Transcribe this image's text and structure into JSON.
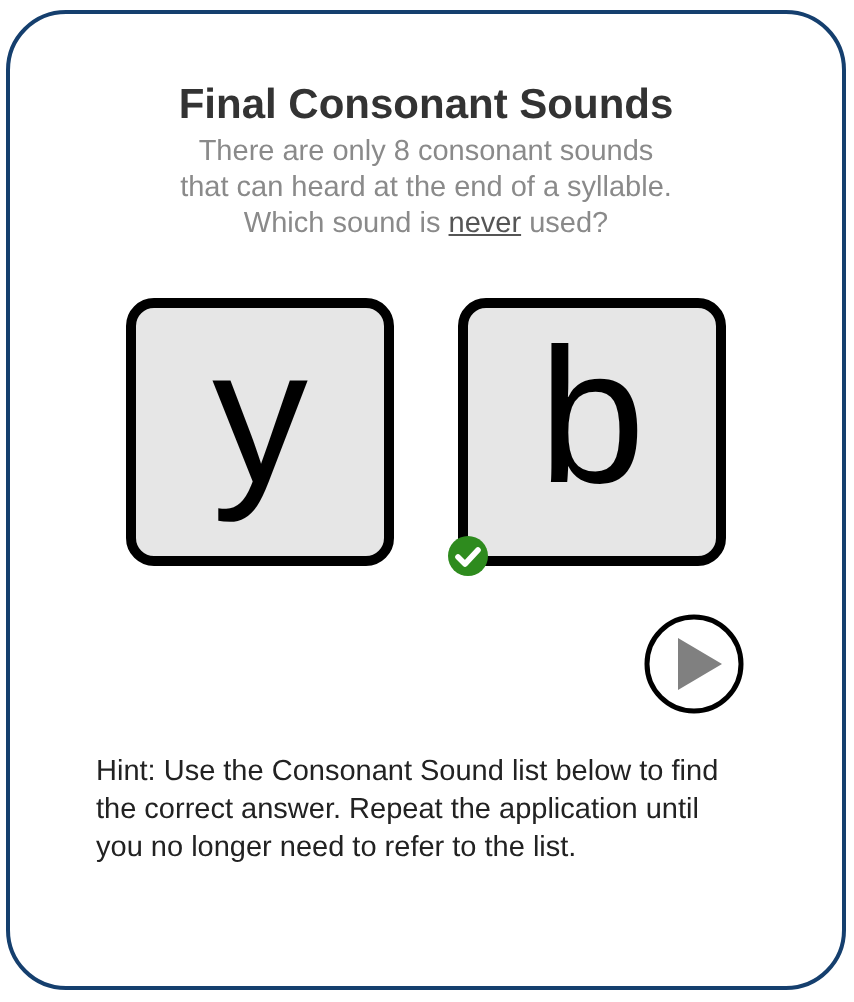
{
  "title": "Final Consonant Sounds",
  "intro": [
    "There are only 8 consonant sounds",
    "that can heard at the end of a syllable."
  ],
  "question": {
    "before": "Which sound is ",
    "underlined": "never",
    "after": " used?"
  },
  "tiles": [
    {
      "letter": "y",
      "correct": false
    },
    {
      "letter": "b",
      "correct": true
    }
  ],
  "hint": "Hint: Use the Consonant Sound list below to find the correct answer. Repeat the application until you no longer need to refer to the list."
}
